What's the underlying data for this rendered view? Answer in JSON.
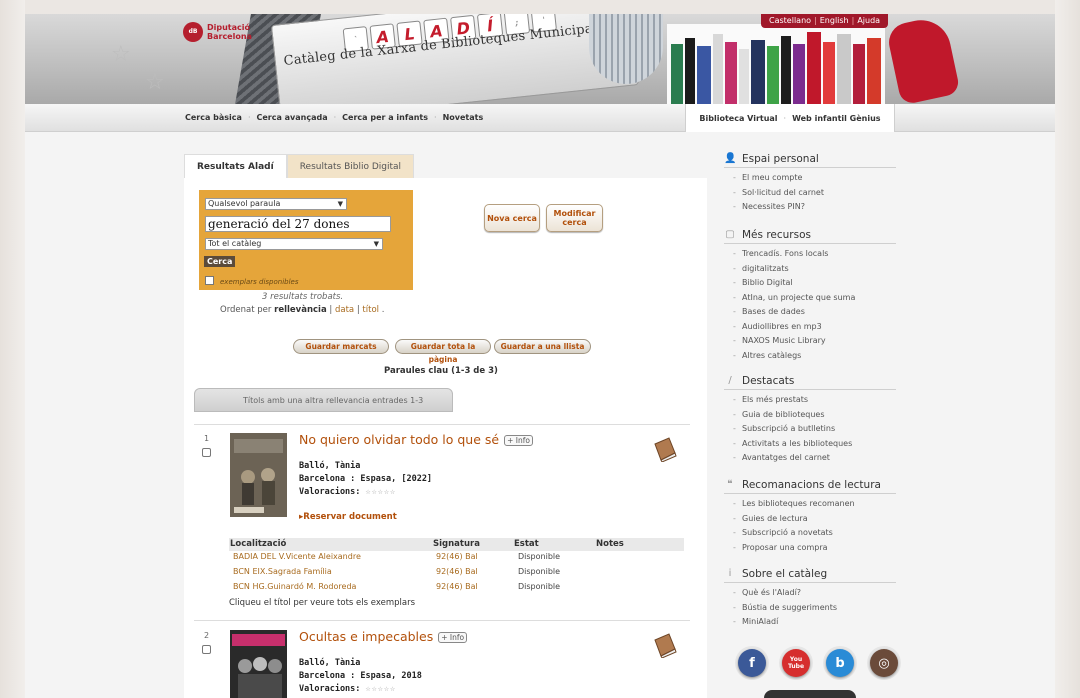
{
  "header": {
    "logo_line1": "Diputació",
    "logo_line2": "Barcelona",
    "logo_mark": "dB",
    "keys": [
      "A",
      "L",
      "A",
      "D",
      "Í"
    ],
    "catalog_title": "Catàleg de la Xarxa de Biblioteques Municipals",
    "languages": [
      "Castellano",
      "English",
      "Ajuda"
    ]
  },
  "nav": {
    "left": [
      "Cerca bàsica",
      "Cerca avançada",
      "Cerca per a infants",
      "Novetats"
    ],
    "right": [
      "Biblioteca Virtual",
      "Web infantil Gènius"
    ]
  },
  "tabs": [
    "Resultats Aladí",
    "Resultats Biblio Digital"
  ],
  "search": {
    "field_select": "Qualsevol paraula",
    "query": "generació del 27 dones",
    "scope_select": "Tot el catàleg",
    "submit_label": "Cerca",
    "available_label": "exemplars disponibles",
    "new_search": "Nova cerca",
    "modify_search_l1": "Modificar",
    "modify_search_l2": "cerca"
  },
  "results": {
    "count_text": "3 resultats trobats.",
    "order_prefix": "Ordenat per",
    "order_active": "rellevància",
    "order_data": "data",
    "order_title": "títol",
    "save_marked": "Guardar marcats",
    "save_page": "Guardar tota la pàgina",
    "save_list": "Guardar a una llista",
    "keywords": "Paraules clau (1-3 de 3)",
    "relevance_tab": "Títols amb una altra rellevancia entrades 1-3"
  },
  "records": [
    {
      "num": "1",
      "title": "No quiero olvidar todo lo que sé",
      "info": "+ Info",
      "author": "Balló, Tània",
      "publisher": "Barcelona : Espasa, [2022]",
      "rating_label": "Valoracions:",
      "rating_stars": "☆☆☆☆☆",
      "reserve": "Reservar document"
    },
    {
      "num": "2",
      "title": "Ocultas e impecables",
      "info": "+ Info",
      "author": "Balló, Tània",
      "publisher": "Barcelona : Espasa, 2018",
      "rating_label": "Valoracions:",
      "rating_stars": "☆☆☆☆☆"
    }
  ],
  "holdings": {
    "headers": [
      "Localització",
      "Signatura",
      "Estat",
      "Notes"
    ],
    "rows": [
      {
        "loc": "BADIA DEL V.Vicente Aleixandre",
        "sig": "92(46) Bal",
        "status": "Disponible"
      },
      {
        "loc": "BCN EIX.Sagrada Família",
        "sig": "92(46) Bal",
        "status": "Disponible"
      },
      {
        "loc": "BCN HG.Guinardó M. Rodoreda",
        "sig": "92(46) Bal",
        "status": "Disponible"
      }
    ],
    "hint": "Cliqueu el títol per veure tots els exemplars"
  },
  "sidebar": {
    "personal": {
      "title": "Espai personal",
      "items": [
        "El meu compte",
        "Sol·licitud del carnet",
        "Necessites PIN?"
      ]
    },
    "resources": {
      "title": "Més recursos",
      "items": [
        "Trencadís. Fons locals",
        "digitalitzats",
        "Biblio Digital",
        "AtIna, un projecte que suma",
        "Bases de dades",
        "Audiollibres en mp3",
        "NAXOS Music Library",
        "Altres catàlegs"
      ]
    },
    "featured": {
      "title": "Destacats",
      "items": [
        "Els més prestats",
        "Guia de biblioteques",
        "Subscripció a butlletins",
        "Activitats a les biblioteques",
        "Avantatges del carnet"
      ]
    },
    "reading": {
      "title": "Recomanacions de lectura",
      "items": [
        "Les biblioteques recomanen",
        "Guies de lectura",
        "Subscripció a novetats",
        "Proposar una compra"
      ]
    },
    "about": {
      "title": "Sobre el catàleg",
      "items": [
        "Què és l'Aladí?",
        "Bústia de suggeriments",
        "MiniAladí"
      ]
    },
    "social": [
      "f",
      "You Tube",
      "b",
      "◎"
    ]
  },
  "colors": {
    "accent_orange": "#e5a53a",
    "link_brown": "#b2500b",
    "brand_red": "#b51f2e"
  }
}
